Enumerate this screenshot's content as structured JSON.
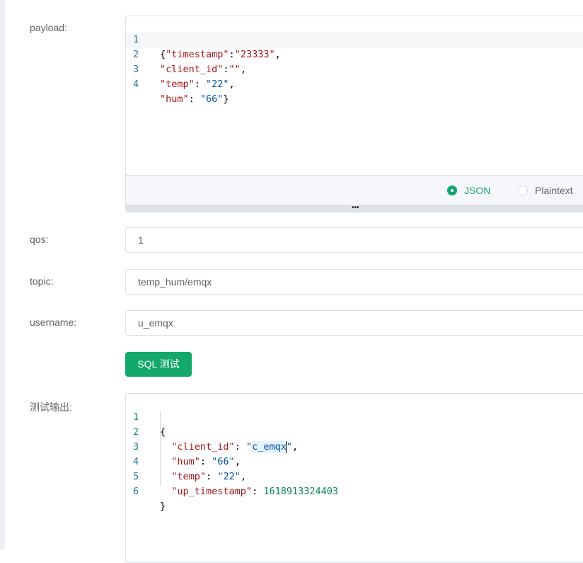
{
  "form": {
    "payload_label": "payload:",
    "qos_label": "qos:",
    "topic_label": "topic:",
    "username_label": "username:",
    "output_label": "测试输出:",
    "qos_value": "1",
    "topic_value": "temp_hum/emqx",
    "username_value": "u_emqx",
    "test_button": "SQL 测试"
  },
  "payload_editor": {
    "line_numbers": [
      "1",
      "2",
      "3",
      "4"
    ],
    "lines": [
      "{\"timestamp\":\"23333\",",
      "\"client_id\":\"\",",
      "\"temp\": \"22\",",
      "\"hum\": \"66\"}"
    ],
    "format_options": [
      "JSON",
      "Plaintext"
    ],
    "selected_format": "JSON"
  },
  "output_editor": {
    "line_numbers": [
      "1",
      "2",
      "3",
      "4",
      "5",
      "6"
    ],
    "lines": [
      "{",
      "  \"client_id\": \"c_emqx\",",
      "  \"hum\": \"66\",",
      "  \"temp\": \"22\",",
      "  \"up_timestamp\": 1618913324403",
      "}"
    ]
  },
  "colors": {
    "accent": "#13a86b",
    "json_key": "#a31515",
    "json_string": "#0451a5",
    "json_number": "#098658",
    "line_number": "#237893"
  }
}
